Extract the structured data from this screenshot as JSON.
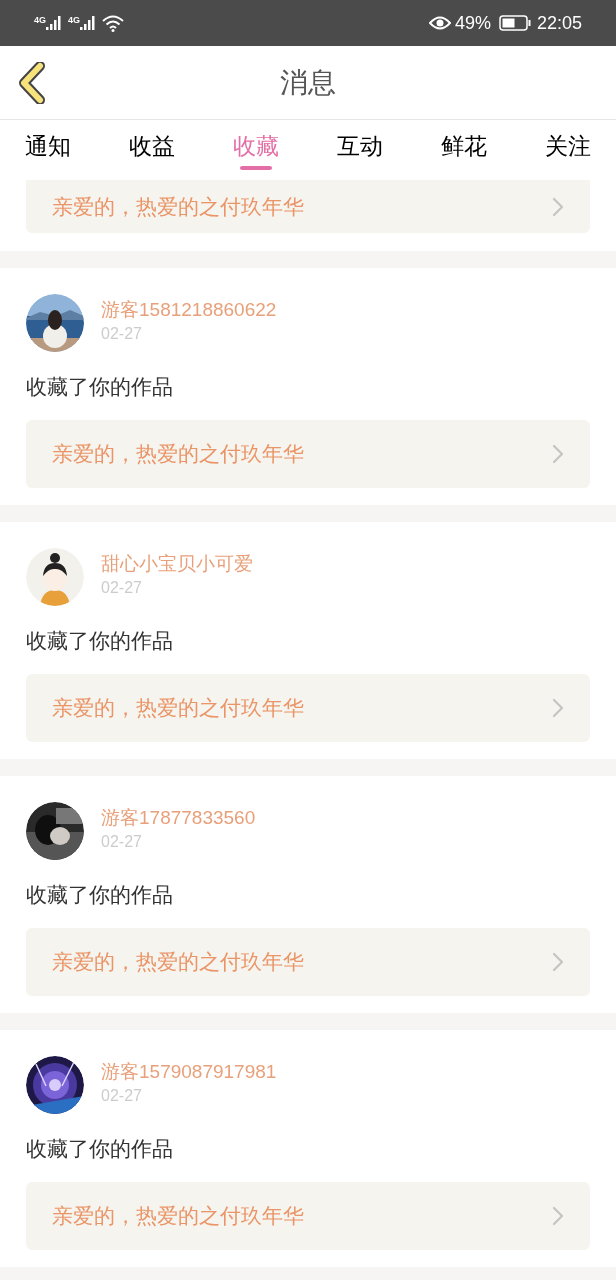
{
  "status_bar": {
    "signals": [
      "4G",
      "4G"
    ],
    "battery_text": "49%",
    "time": "22:05"
  },
  "header": {
    "title": "消息"
  },
  "tabs": [
    {
      "label": "通知",
      "selected": false
    },
    {
      "label": "收益",
      "selected": false
    },
    {
      "label": "收藏",
      "selected": true
    },
    {
      "label": "互动",
      "selected": false
    },
    {
      "label": "鲜花",
      "selected": false
    },
    {
      "label": "关注",
      "selected": false
    }
  ],
  "partial_item": {
    "work_title": "亲爱的，热爱的之付玖年华"
  },
  "items": [
    {
      "name": "游客1581218860622",
      "date": "02-27",
      "action": "收藏了你的作品",
      "work_title": "亲爱的，热爱的之付玖年华"
    },
    {
      "name": "甜心小宝贝小可爱",
      "date": "02-27",
      "action": "收藏了你的作品",
      "work_title": "亲爱的，热爱的之付玖年华"
    },
    {
      "name": "游客17877833560",
      "date": "02-27",
      "action": "收藏了你的作品",
      "work_title": "亲爱的，热爱的之付玖年华"
    },
    {
      "name": "游客1579087917981",
      "date": "02-27",
      "action": "收藏了你的作品",
      "work_title": "亲爱的，热爱的之付玖年华"
    }
  ]
}
